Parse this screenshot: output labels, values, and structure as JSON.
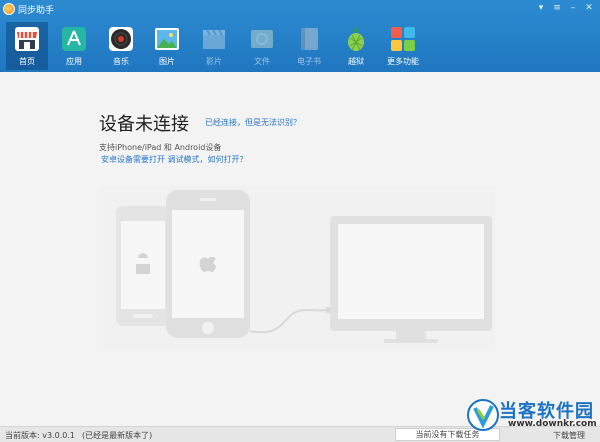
{
  "window": {
    "title": "同步助手"
  },
  "toolbar": {
    "items": [
      {
        "label": "首页",
        "icon": "store-icon",
        "color": "#e54d3c",
        "active": true,
        "enabled": true
      },
      {
        "label": "应用",
        "icon": "app-store-icon",
        "color": "#27b5a6",
        "active": false,
        "enabled": true
      },
      {
        "label": "音乐",
        "icon": "music-record-icon",
        "color": "#2a2a2a",
        "active": false,
        "enabled": true
      },
      {
        "label": "图片",
        "icon": "picture-icon",
        "color": "#3fa7e0",
        "active": false,
        "enabled": true
      },
      {
        "label": "影片",
        "icon": "clapperboard-icon",
        "color": "#7fb0dc",
        "active": false,
        "enabled": false
      },
      {
        "label": "文件",
        "icon": "folder-icon",
        "color": "#9fc39a",
        "active": false,
        "enabled": false
      },
      {
        "label": "电子书",
        "icon": "book-icon",
        "color": "#8f8f8f",
        "active": false,
        "enabled": false
      },
      {
        "label": "越狱",
        "icon": "pineapple-icon",
        "color": "#6fbf3c",
        "active": false,
        "enabled": true
      },
      {
        "label": "更多功能",
        "icon": "more-tiles-icon",
        "color": "#f08a2a",
        "active": false,
        "enabled": true
      }
    ]
  },
  "main": {
    "heading": "设备未连接",
    "connected_link": "已经连接，但是无法识别？",
    "support_text": "支持iPhone/iPad 和 Android设备",
    "android_link": "安卓设备需要打开 调试模式，如何打开？"
  },
  "status": {
    "version_label": "当前版本: v3.0.0.1",
    "version_note": "(已经是最新版本了)",
    "download_status": "当前没有下载任务",
    "download_manage": "下载管理"
  },
  "watermark": {
    "text": "当客软件园",
    "url": "www.downkr.com"
  },
  "colors": {
    "titlebar": "#1f77c0",
    "link": "#2a77c9",
    "device": "#e2e2e2"
  }
}
